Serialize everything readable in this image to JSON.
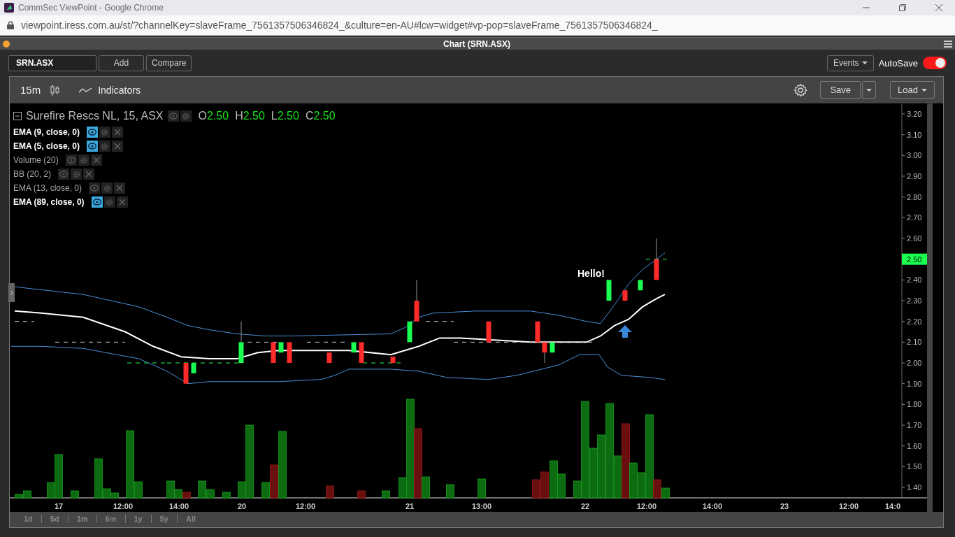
{
  "browser": {
    "title": "CommSec ViewPoint - Google Chrome",
    "url": "viewpoint.iress.com.au/st/?channelKey=slaveFrame_7561357506346824_&culture=en-AU#lcw=widget#vp-pop=slaveFrame_7561357506346824_"
  },
  "window": {
    "title": "Chart (SRN.ASX)"
  },
  "toolbar": {
    "symbol": "SRN.ASX",
    "buttons": [
      "Add",
      "Compare"
    ],
    "events": "Events",
    "autosave": {
      "label": "AutoSave",
      "on": true
    }
  },
  "chart_toolbar": {
    "interval": "15m",
    "indicators": "Indicators",
    "save": "Save",
    "load": "Load"
  },
  "legend": {
    "title": "Surefire Rescs NL, 15, ASX",
    "ohlc": [
      {
        "label": "O",
        "value": "2.50"
      },
      {
        "label": "H",
        "value": "2.50"
      },
      {
        "label": "L",
        "value": "2.50"
      },
      {
        "label": "C",
        "value": "2.50"
      }
    ],
    "indicators": [
      {
        "label": "EMA (9, close, 0)",
        "visible": true
      },
      {
        "label": "EMA (5, close, 0)",
        "visible": true
      },
      {
        "label": "Volume (20)",
        "visible": false
      },
      {
        "label": "BB (20, 2)",
        "visible": false
      },
      {
        "label": "EMA (13, close, 0)",
        "visible": false
      },
      {
        "label": "EMA (89, close, 0)",
        "visible": true
      }
    ]
  },
  "annotation": "Hello!",
  "price_axis": {
    "labels": [
      "3.20",
      "3.10",
      "3.00",
      "2.90",
      "2.80",
      "2.70",
      "2.60",
      "2.40",
      "2.30",
      "2.20",
      "2.10",
      "2.00",
      "1.90",
      "1.80",
      "1.70",
      "1.60",
      "1.50",
      "1.40"
    ],
    "last_price": "2.50"
  },
  "time_axis": {
    "labels": [
      "17",
      "12:00",
      "14:00",
      "20",
      "12:00",
      "21",
      "13:00",
      "22",
      "12:00",
      "14:00",
      "23",
      "12:00",
      "14:0"
    ]
  },
  "ranges": [
    "1d",
    "5d",
    "1m",
    "6m",
    "1y",
    "5y",
    "All"
  ]
}
